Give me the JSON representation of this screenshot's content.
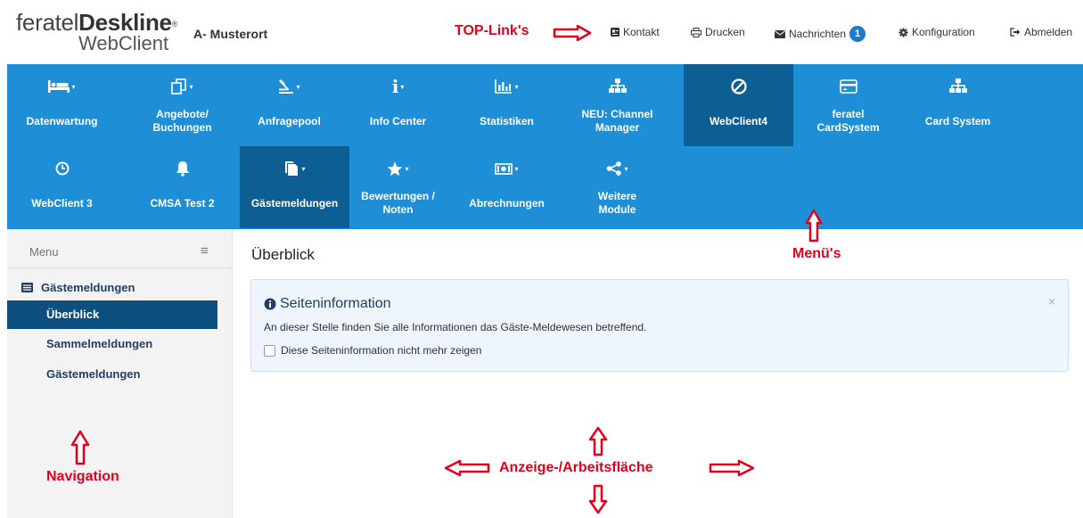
{
  "header": {
    "logo_line1_a": "feratel",
    "logo_line1_b": "Deskline",
    "logo_reg": "®",
    "logo_line2": "WebClient",
    "location": "A- Musterort"
  },
  "annotations": {
    "toplinks": "TOP-Link's",
    "menus": "Menü's",
    "navigation": "Navigation",
    "workarea": "Anzeige-/Arbeitsfläche",
    "color": "#e3001b"
  },
  "toplinks": {
    "kontakt": "Kontakt",
    "drucken": "Drucken",
    "nachrichten": "Nachrichten",
    "nachrichten_count": "1",
    "konfiguration": "Konfiguration",
    "abmelden": "Abmelden"
  },
  "menu": {
    "accent": "#1e8fd6",
    "active_color": "#0d5e93",
    "row1": [
      {
        "label": "Datenwartung",
        "icon": "bed-icon"
      },
      {
        "label": "Angebote/\nBuchungen",
        "icon": "offers-icon"
      },
      {
        "label": "Anfragepool",
        "icon": "inquiry-icon"
      },
      {
        "label": "Info Center",
        "icon": "info-icon"
      },
      {
        "label": "Statistiken",
        "icon": "bar-chart-icon"
      },
      {
        "label": "NEU: Channel\nManager",
        "icon": "sitemap-icon"
      },
      {
        "label": "WebClient4",
        "icon": "ban-icon"
      },
      {
        "label": "feratel\nCardSystem",
        "icon": "credit-card-icon"
      },
      {
        "label": "Card System",
        "icon": "sitemap-icon"
      }
    ],
    "row2": [
      {
        "label": "WebClient 3",
        "icon": "clock-icon"
      },
      {
        "label": "CMSA Test 2",
        "icon": "bell-icon"
      },
      {
        "label": "Gästemeldungen",
        "icon": "documents-icon"
      },
      {
        "label": "Bewertungen /\nNoten",
        "icon": "star-icon"
      },
      {
        "label": "Abrechnungen",
        "icon": "money-icon"
      },
      {
        "label": "Weitere\nModule",
        "icon": "share-icon"
      }
    ]
  },
  "sidebar": {
    "title": "Menu",
    "group": "Gästemeldungen",
    "items": [
      "Überblick",
      "Sammelmeldungen",
      "Gästemeldungen"
    ]
  },
  "main": {
    "title": "Überblick",
    "info": {
      "title": "Seiteninformation",
      "text": "An dieser Stelle finden Sie alle Informationen das Gäste-Meldewesen betreffend.",
      "checkbox": "Diese Seiteninformation nicht mehr zeigen",
      "close": "×"
    }
  }
}
